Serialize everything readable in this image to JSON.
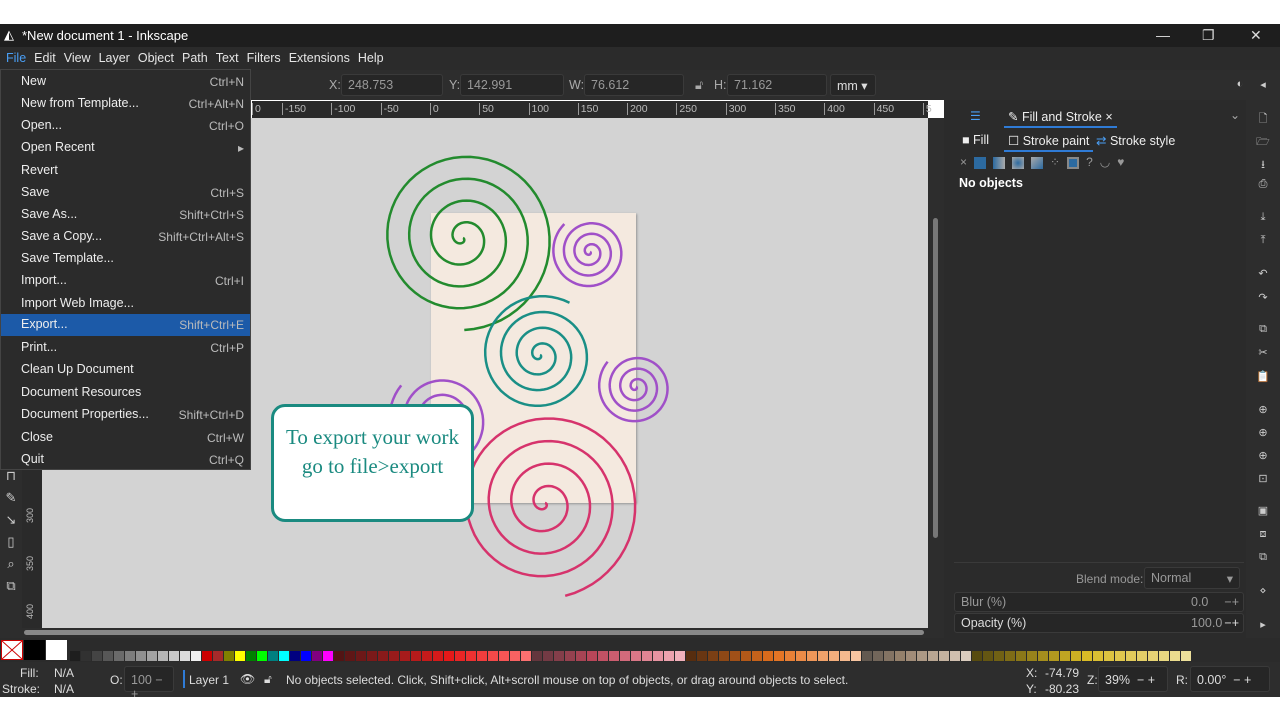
{
  "window": {
    "title": "*New document 1 - Inkscape"
  },
  "menubar": [
    "File",
    "Edit",
    "View",
    "Layer",
    "Object",
    "Path",
    "Text",
    "Filters",
    "Extensions",
    "Help"
  ],
  "file_menu": [
    {
      "label": "New",
      "shortcut": "Ctrl+N"
    },
    {
      "label": "New from Template...",
      "shortcut": "Ctrl+Alt+N"
    },
    {
      "label": "Open...",
      "shortcut": "Ctrl+O"
    },
    {
      "label": "Open Recent",
      "shortcut": "▸"
    },
    {
      "label": "Revert",
      "shortcut": ""
    },
    {
      "label": "Save",
      "shortcut": "Ctrl+S"
    },
    {
      "label": "Save As...",
      "shortcut": "Shift+Ctrl+S"
    },
    {
      "label": "Save a Copy...",
      "shortcut": "Shift+Ctrl+Alt+S"
    },
    {
      "label": "Save Template...",
      "shortcut": ""
    },
    {
      "label": "Import...",
      "shortcut": "Ctrl+I"
    },
    {
      "label": "Import Web Image...",
      "shortcut": ""
    },
    {
      "label": "Export...",
      "shortcut": "Shift+Ctrl+E",
      "highlighted": true
    },
    {
      "label": "Print...",
      "shortcut": "Ctrl+P"
    },
    {
      "label": "Clean Up Document",
      "shortcut": ""
    },
    {
      "label": "Document Resources",
      "shortcut": ""
    },
    {
      "label": "Document Properties...",
      "shortcut": "Shift+Ctrl+D"
    },
    {
      "label": "Close",
      "shortcut": "Ctrl+W"
    },
    {
      "label": "Quit",
      "shortcut": "Ctrl+Q"
    }
  ],
  "toolbar": {
    "x_label": "X:",
    "x": "248.753",
    "y_label": "Y:",
    "y": "142.991",
    "w_label": "W:",
    "w": "76.612",
    "h_label": "H:",
    "h": "71.162",
    "unit": "mm"
  },
  "ruler_ticks": [
    "0",
    "-150",
    "-100",
    "-50",
    "0",
    "50",
    "100",
    "150",
    "200",
    "250",
    "300",
    "350",
    "400",
    "450",
    "5"
  ],
  "ruler_left_ticks": [
    "300",
    "350",
    "400"
  ],
  "panel": {
    "tab": "Fill and Stroke",
    "subtabs": [
      "Fill",
      "Stroke paint",
      "Stroke style"
    ],
    "status": "No objects",
    "blend_label": "Blend mode:",
    "blend_value": "Normal",
    "blur_label": "Blur (%)",
    "blur_value": "0.0",
    "opacity_label": "Opacity (%)",
    "opacity_value": "100.0"
  },
  "callout": "To export your work go to file>export",
  "status": {
    "fill_label": "Fill:",
    "fill": "N/A",
    "stroke_label": "Stroke:",
    "stroke": "N/A",
    "opacity_label": "O:",
    "opacity": "100",
    "layer": "Layer 1",
    "message": "No objects selected. Click, Shift+click, Alt+scroll mouse on top of objects, or drag around objects to select.",
    "x_label": "X:",
    "x": "-74.79",
    "y_label": "Y:",
    "y": "-80.23",
    "zoom_label": "Z:",
    "zoom": "39%",
    "rotate_label": "R:",
    "rotate": "0.00°"
  },
  "colors": {
    "accent": "#1c5aa8",
    "green": "#238b2e",
    "purple": "#a050c8",
    "teal": "#1a8f86",
    "crimson": "#d6336c",
    "page": "#f4e9df"
  }
}
